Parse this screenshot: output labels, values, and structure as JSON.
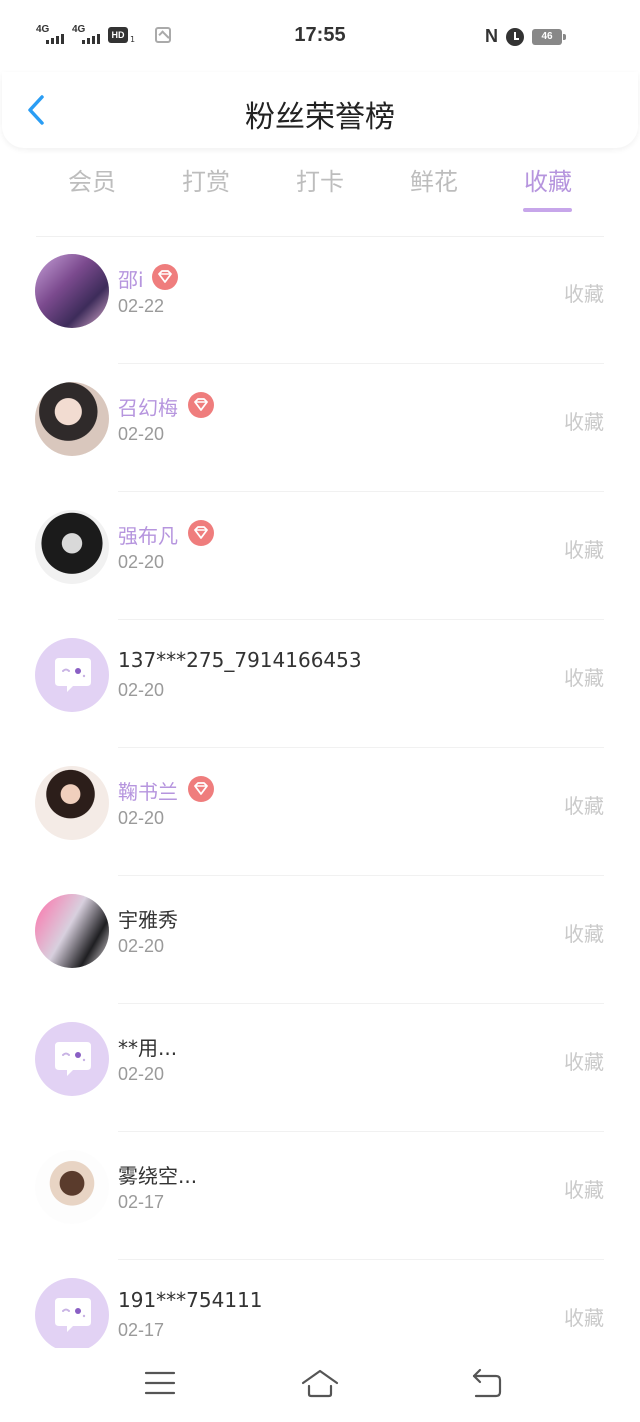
{
  "status_bar": {
    "signal1": "4G",
    "signal2": "4G",
    "hd": "HD",
    "hd_sub": "1",
    "time": "17:55",
    "nfc": "N",
    "battery": "46"
  },
  "header": {
    "title": "粉丝荣誉榜"
  },
  "tabs": [
    {
      "label": "会员"
    },
    {
      "label": "打赏"
    },
    {
      "label": "打卡"
    },
    {
      "label": "鲜花"
    },
    {
      "label": "收藏"
    }
  ],
  "active_tab": "收藏",
  "colors": {
    "accent": "#b695de",
    "vip_badge": "#ef7d7d",
    "default_avatar": "#e2d2f4"
  },
  "rows": [
    {
      "name": "邵i",
      "date": "02-22",
      "action": "收藏",
      "vip": true,
      "avatar": "photo"
    },
    {
      "name": "召幻梅",
      "date": "02-20",
      "action": "收藏",
      "vip": true,
      "avatar": "photo"
    },
    {
      "name": "强布凡",
      "date": "02-20",
      "action": "收藏",
      "vip": true,
      "avatar": "photo"
    },
    {
      "name": "137***275_7914166453",
      "date": "02-20",
      "action": "收藏",
      "vip": false,
      "avatar": "default"
    },
    {
      "name": "鞠书兰",
      "date": "02-20",
      "action": "收藏",
      "vip": true,
      "avatar": "photo"
    },
    {
      "name": "宇雅秀",
      "date": "02-20",
      "action": "收藏",
      "vip": false,
      "avatar": "photo"
    },
    {
      "name": "**用...",
      "date": "02-20",
      "action": "收藏",
      "vip": false,
      "avatar": "default"
    },
    {
      "name": "雾绕空...",
      "date": "02-17",
      "action": "收藏",
      "vip": false,
      "avatar": "photo"
    },
    {
      "name": "191***754111",
      "date": "02-17",
      "action": "收藏",
      "vip": false,
      "avatar": "default"
    }
  ]
}
